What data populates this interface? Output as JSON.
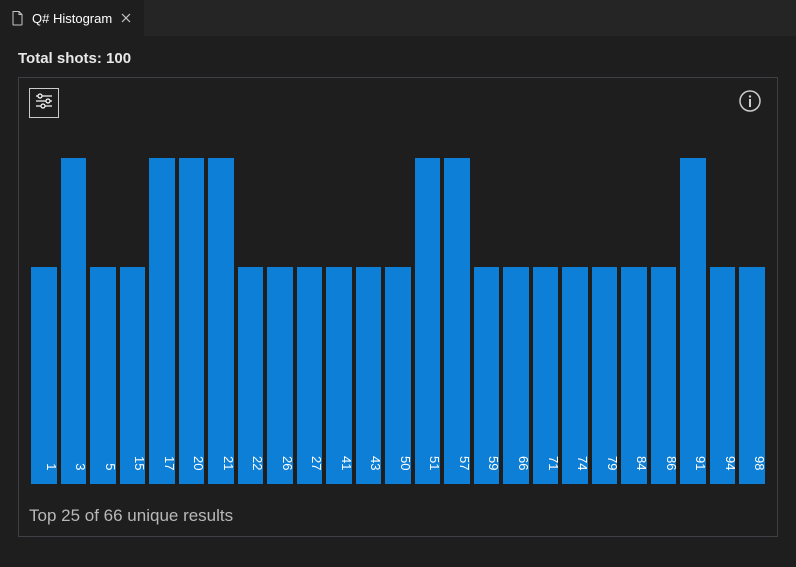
{
  "tab": {
    "title": "Q# Histogram"
  },
  "header": {
    "total_shots_label": "Total shots: 100"
  },
  "footer": {
    "caption": "Top 25 of 66 unique results"
  },
  "colors": {
    "bar": "#0e7fd7",
    "bg": "#1e1e1e",
    "panel_border": "#3f3f46"
  },
  "chart_data": {
    "type": "bar",
    "title": "Q# Histogram",
    "xlabel": "",
    "ylabel": "",
    "ylim": [
      0,
      3
    ],
    "categories": [
      "1",
      "3",
      "5",
      "15",
      "17",
      "20",
      "21",
      "22",
      "26",
      "27",
      "41",
      "43",
      "50",
      "51",
      "57",
      "59",
      "66",
      "71",
      "74",
      "79",
      "84",
      "86",
      "91",
      "94",
      "98"
    ],
    "values": [
      2,
      3,
      2,
      2,
      3,
      3,
      3,
      2,
      2,
      2,
      2,
      2,
      2,
      3,
      3,
      2,
      2,
      2,
      2,
      2,
      2,
      2,
      3,
      2,
      2
    ]
  }
}
